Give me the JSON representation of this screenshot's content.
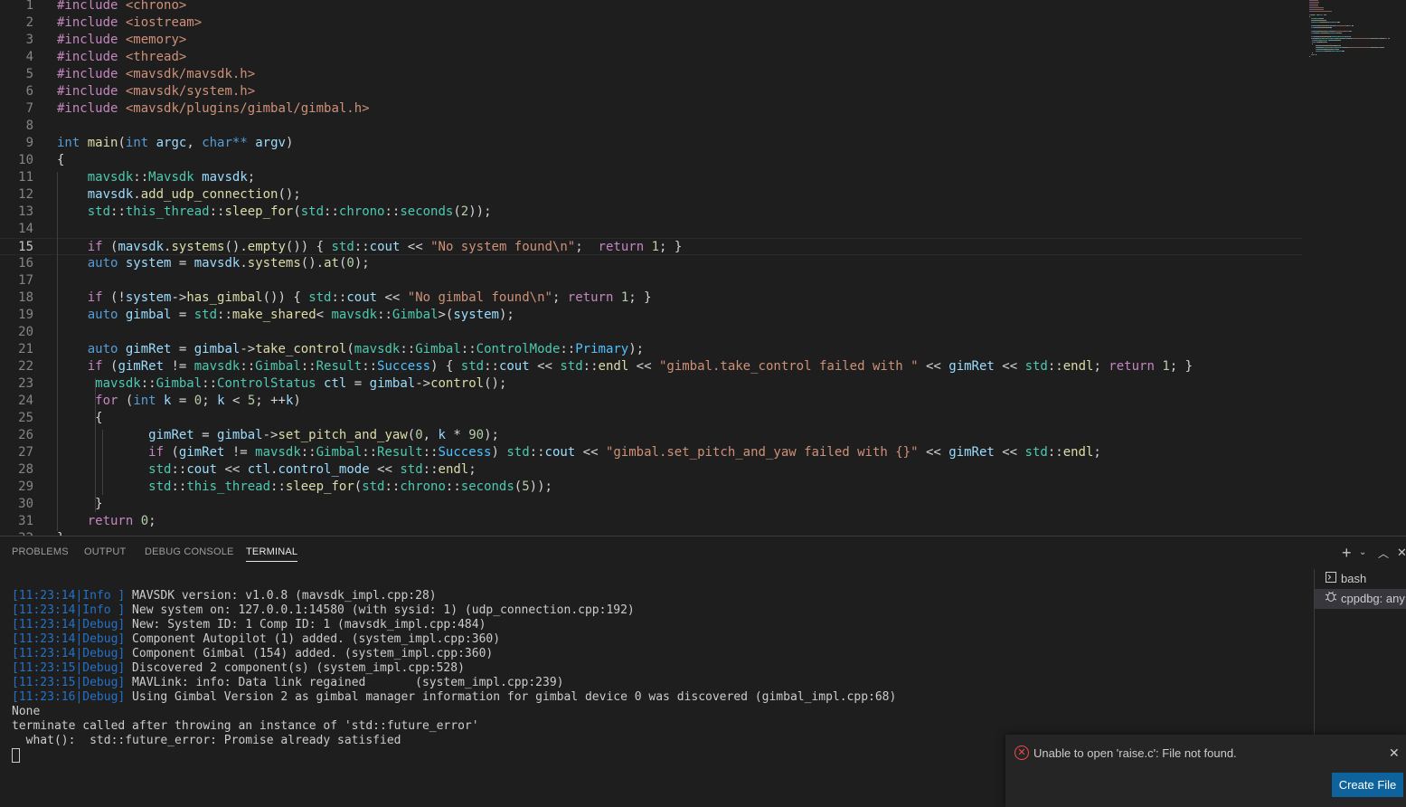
{
  "editor": {
    "current_line": 15,
    "lines": [
      [
        [
          "#include",
          "#c586c0"
        ],
        [
          " <chrono>",
          "#ce9178"
        ]
      ],
      [
        [
          "#include",
          "#c586c0"
        ],
        [
          " <iostream>",
          "#ce9178"
        ]
      ],
      [
        [
          "#include",
          "#c586c0"
        ],
        [
          " <memory>",
          "#ce9178"
        ]
      ],
      [
        [
          "#include",
          "#c586c0"
        ],
        [
          " <thread>",
          "#ce9178"
        ]
      ],
      [
        [
          "#include",
          "#c586c0"
        ],
        [
          " <mavsdk/mavsdk.h>",
          "#ce9178"
        ]
      ],
      [
        [
          "#include",
          "#c586c0"
        ],
        [
          " <mavsdk/system.h>",
          "#ce9178"
        ]
      ],
      [
        [
          "#include",
          "#c586c0"
        ],
        [
          " <mavsdk/plugins/gimbal/gimbal.h>",
          "#ce9178"
        ]
      ],
      [],
      [
        [
          "int",
          "#569cd6"
        ],
        [
          " ",
          "#d4d4d4"
        ],
        [
          "main",
          "#dcdcaa"
        ],
        [
          "(",
          "#d4d4d4"
        ],
        [
          "int",
          "#569cd6"
        ],
        [
          " ",
          "#d4d4d4"
        ],
        [
          "argc",
          "#9cdcfe"
        ],
        [
          ", ",
          "#d4d4d4"
        ],
        [
          "char**",
          "#569cd6"
        ],
        [
          " ",
          "#d4d4d4"
        ],
        [
          "argv",
          "#9cdcfe"
        ],
        [
          ")",
          "#d4d4d4"
        ]
      ],
      [
        [
          "{",
          "#d4d4d4"
        ]
      ],
      [
        [
          "    ",
          "#d4d4d4"
        ],
        [
          "mavsdk",
          "#4ec9b0"
        ],
        [
          "::",
          "#d4d4d4"
        ],
        [
          "Mavsdk",
          "#4ec9b0"
        ],
        [
          " ",
          "#d4d4d4"
        ],
        [
          "mavsdk",
          "#9cdcfe"
        ],
        [
          ";",
          "#d4d4d4"
        ]
      ],
      [
        [
          "    ",
          "#d4d4d4"
        ],
        [
          "mavsdk",
          "#9cdcfe"
        ],
        [
          ".",
          "#d4d4d4"
        ],
        [
          "add_udp_connection",
          "#dcdcaa"
        ],
        [
          "();",
          "#d4d4d4"
        ]
      ],
      [
        [
          "    ",
          "#d4d4d4"
        ],
        [
          "std",
          "#4ec9b0"
        ],
        [
          "::",
          "#d4d4d4"
        ],
        [
          "this_thread",
          "#4ec9b0"
        ],
        [
          "::",
          "#d4d4d4"
        ],
        [
          "sleep_for",
          "#dcdcaa"
        ],
        [
          "(",
          "#d4d4d4"
        ],
        [
          "std",
          "#4ec9b0"
        ],
        [
          "::",
          "#d4d4d4"
        ],
        [
          "chrono",
          "#4ec9b0"
        ],
        [
          "::",
          "#d4d4d4"
        ],
        [
          "seconds",
          "#4ec9b0"
        ],
        [
          "(",
          "#d4d4d4"
        ],
        [
          "2",
          "#b5cea8"
        ],
        [
          "));",
          "#d4d4d4"
        ]
      ],
      [],
      [
        [
          "    ",
          "#d4d4d4"
        ],
        [
          "if",
          "#c586c0"
        ],
        [
          " (",
          "#d4d4d4"
        ],
        [
          "mavsdk",
          "#9cdcfe"
        ],
        [
          ".",
          "#d4d4d4"
        ],
        [
          "systems",
          "#dcdcaa"
        ],
        [
          "().",
          "#d4d4d4"
        ],
        [
          "empty",
          "#dcdcaa"
        ],
        [
          "()) { ",
          "#d4d4d4"
        ],
        [
          "std",
          "#4ec9b0"
        ],
        [
          "::",
          "#d4d4d4"
        ],
        [
          "cout",
          "#9cdcfe"
        ],
        [
          " << ",
          "#d4d4d4"
        ],
        [
          "\"No system found\\n\"",
          "#ce9178"
        ],
        [
          ";  ",
          "#d4d4d4"
        ],
        [
          "return",
          "#c586c0"
        ],
        [
          " ",
          "#d4d4d4"
        ],
        [
          "1",
          "#b5cea8"
        ],
        [
          "; }",
          "#d4d4d4"
        ]
      ],
      [
        [
          "    ",
          "#d4d4d4"
        ],
        [
          "auto",
          "#569cd6"
        ],
        [
          " ",
          "#d4d4d4"
        ],
        [
          "system",
          "#9cdcfe"
        ],
        [
          " = ",
          "#d4d4d4"
        ],
        [
          "mavsdk",
          "#9cdcfe"
        ],
        [
          ".",
          "#d4d4d4"
        ],
        [
          "systems",
          "#dcdcaa"
        ],
        [
          "().",
          "#d4d4d4"
        ],
        [
          "at",
          "#dcdcaa"
        ],
        [
          "(",
          "#d4d4d4"
        ],
        [
          "0",
          "#b5cea8"
        ],
        [
          ");",
          "#d4d4d4"
        ]
      ],
      [],
      [
        [
          "    ",
          "#d4d4d4"
        ],
        [
          "if",
          "#c586c0"
        ],
        [
          " (!",
          "#d4d4d4"
        ],
        [
          "system",
          "#9cdcfe"
        ],
        [
          "->",
          "#d4d4d4"
        ],
        [
          "has_gimbal",
          "#dcdcaa"
        ],
        [
          "()) { ",
          "#d4d4d4"
        ],
        [
          "std",
          "#4ec9b0"
        ],
        [
          "::",
          "#d4d4d4"
        ],
        [
          "cout",
          "#9cdcfe"
        ],
        [
          " << ",
          "#d4d4d4"
        ],
        [
          "\"No gimbal found\\n\"",
          "#ce9178"
        ],
        [
          "; ",
          "#d4d4d4"
        ],
        [
          "return",
          "#c586c0"
        ],
        [
          " ",
          "#d4d4d4"
        ],
        [
          "1",
          "#b5cea8"
        ],
        [
          "; }",
          "#d4d4d4"
        ]
      ],
      [
        [
          "    ",
          "#d4d4d4"
        ],
        [
          "auto",
          "#569cd6"
        ],
        [
          " ",
          "#d4d4d4"
        ],
        [
          "gimbal",
          "#9cdcfe"
        ],
        [
          " = ",
          "#d4d4d4"
        ],
        [
          "std",
          "#4ec9b0"
        ],
        [
          "::",
          "#d4d4d4"
        ],
        [
          "make_shared",
          "#dcdcaa"
        ],
        [
          "< ",
          "#d4d4d4"
        ],
        [
          "mavsdk",
          "#4ec9b0"
        ],
        [
          "::",
          "#d4d4d4"
        ],
        [
          "Gimbal",
          "#4ec9b0"
        ],
        [
          ">(",
          "#d4d4d4"
        ],
        [
          "system",
          "#9cdcfe"
        ],
        [
          ");",
          "#d4d4d4"
        ]
      ],
      [],
      [
        [
          "    ",
          "#d4d4d4"
        ],
        [
          "auto",
          "#569cd6"
        ],
        [
          " ",
          "#d4d4d4"
        ],
        [
          "gimRet",
          "#9cdcfe"
        ],
        [
          " = ",
          "#d4d4d4"
        ],
        [
          "gimbal",
          "#9cdcfe"
        ],
        [
          "->",
          "#d4d4d4"
        ],
        [
          "take_control",
          "#dcdcaa"
        ],
        [
          "(",
          "#d4d4d4"
        ],
        [
          "mavsdk",
          "#4ec9b0"
        ],
        [
          "::",
          "#d4d4d4"
        ],
        [
          "Gimbal",
          "#4ec9b0"
        ],
        [
          "::",
          "#d4d4d4"
        ],
        [
          "ControlMode",
          "#4ec9b0"
        ],
        [
          "::",
          "#d4d4d4"
        ],
        [
          "Primary",
          "#4fc1ff"
        ],
        [
          ");",
          "#d4d4d4"
        ]
      ],
      [
        [
          "    ",
          "#d4d4d4"
        ],
        [
          "if",
          "#c586c0"
        ],
        [
          " (",
          "#d4d4d4"
        ],
        [
          "gimRet",
          "#9cdcfe"
        ],
        [
          " != ",
          "#d4d4d4"
        ],
        [
          "mavsdk",
          "#4ec9b0"
        ],
        [
          "::",
          "#d4d4d4"
        ],
        [
          "Gimbal",
          "#4ec9b0"
        ],
        [
          "::",
          "#d4d4d4"
        ],
        [
          "Result",
          "#4ec9b0"
        ],
        [
          "::",
          "#d4d4d4"
        ],
        [
          "Success",
          "#4fc1ff"
        ],
        [
          ") { ",
          "#d4d4d4"
        ],
        [
          "std",
          "#4ec9b0"
        ],
        [
          "::",
          "#d4d4d4"
        ],
        [
          "cout",
          "#9cdcfe"
        ],
        [
          " << ",
          "#d4d4d4"
        ],
        [
          "std",
          "#4ec9b0"
        ],
        [
          "::",
          "#d4d4d4"
        ],
        [
          "endl",
          "#dcdcaa"
        ],
        [
          " << ",
          "#d4d4d4"
        ],
        [
          "\"gimbal.take_control failed with \"",
          "#ce9178"
        ],
        [
          " << ",
          "#d4d4d4"
        ],
        [
          "gimRet",
          "#9cdcfe"
        ],
        [
          " << ",
          "#d4d4d4"
        ],
        [
          "std",
          "#4ec9b0"
        ],
        [
          "::",
          "#d4d4d4"
        ],
        [
          "endl",
          "#dcdcaa"
        ],
        [
          "; ",
          "#d4d4d4"
        ],
        [
          "return",
          "#c586c0"
        ],
        [
          " ",
          "#d4d4d4"
        ],
        [
          "1",
          "#b5cea8"
        ],
        [
          "; }",
          "#d4d4d4"
        ]
      ],
      [
        [
          "     ",
          "#d4d4d4"
        ],
        [
          "mavsdk",
          "#4ec9b0"
        ],
        [
          "::",
          "#d4d4d4"
        ],
        [
          "Gimbal",
          "#4ec9b0"
        ],
        [
          "::",
          "#d4d4d4"
        ],
        [
          "ControlStatus",
          "#4ec9b0"
        ],
        [
          " ",
          "#d4d4d4"
        ],
        [
          "ctl",
          "#9cdcfe"
        ],
        [
          " = ",
          "#d4d4d4"
        ],
        [
          "gimbal",
          "#9cdcfe"
        ],
        [
          "->",
          "#d4d4d4"
        ],
        [
          "control",
          "#dcdcaa"
        ],
        [
          "();",
          "#d4d4d4"
        ]
      ],
      [
        [
          "     ",
          "#d4d4d4"
        ],
        [
          "for",
          "#c586c0"
        ],
        [
          " (",
          "#d4d4d4"
        ],
        [
          "int",
          "#569cd6"
        ],
        [
          " ",
          "#d4d4d4"
        ],
        [
          "k",
          "#9cdcfe"
        ],
        [
          " = ",
          "#d4d4d4"
        ],
        [
          "0",
          "#b5cea8"
        ],
        [
          "; ",
          "#d4d4d4"
        ],
        [
          "k",
          "#9cdcfe"
        ],
        [
          " < ",
          "#d4d4d4"
        ],
        [
          "5",
          "#b5cea8"
        ],
        [
          "; ++",
          "#d4d4d4"
        ],
        [
          "k",
          "#9cdcfe"
        ],
        [
          ")",
          "#d4d4d4"
        ]
      ],
      [
        [
          "     ",
          "#d4d4d4"
        ],
        [
          "{",
          "#d4d4d4"
        ]
      ],
      [
        [
          "            ",
          "#d4d4d4"
        ],
        [
          "gimRet",
          "#9cdcfe"
        ],
        [
          " = ",
          "#d4d4d4"
        ],
        [
          "gimbal",
          "#9cdcfe"
        ],
        [
          "->",
          "#d4d4d4"
        ],
        [
          "set_pitch_and_yaw",
          "#dcdcaa"
        ],
        [
          "(",
          "#d4d4d4"
        ],
        [
          "0",
          "#b5cea8"
        ],
        [
          ", ",
          "#d4d4d4"
        ],
        [
          "k",
          "#9cdcfe"
        ],
        [
          " * ",
          "#d4d4d4"
        ],
        [
          "90",
          "#b5cea8"
        ],
        [
          ");",
          "#d4d4d4"
        ]
      ],
      [
        [
          "            ",
          "#d4d4d4"
        ],
        [
          "if",
          "#c586c0"
        ],
        [
          " (",
          "#d4d4d4"
        ],
        [
          "gimRet",
          "#9cdcfe"
        ],
        [
          " != ",
          "#d4d4d4"
        ],
        [
          "mavsdk",
          "#4ec9b0"
        ],
        [
          "::",
          "#d4d4d4"
        ],
        [
          "Gimbal",
          "#4ec9b0"
        ],
        [
          "::",
          "#d4d4d4"
        ],
        [
          "Result",
          "#4ec9b0"
        ],
        [
          "::",
          "#d4d4d4"
        ],
        [
          "Success",
          "#4fc1ff"
        ],
        [
          ") ",
          "#d4d4d4"
        ],
        [
          "std",
          "#4ec9b0"
        ],
        [
          "::",
          "#d4d4d4"
        ],
        [
          "cout",
          "#9cdcfe"
        ],
        [
          " << ",
          "#d4d4d4"
        ],
        [
          "\"gimbal.set_pitch_and_yaw failed with {}\"",
          "#ce9178"
        ],
        [
          " << ",
          "#d4d4d4"
        ],
        [
          "gimRet",
          "#9cdcfe"
        ],
        [
          " << ",
          "#d4d4d4"
        ],
        [
          "std",
          "#4ec9b0"
        ],
        [
          "::",
          "#d4d4d4"
        ],
        [
          "endl",
          "#dcdcaa"
        ],
        [
          ";",
          "#d4d4d4"
        ]
      ],
      [
        [
          "            ",
          "#d4d4d4"
        ],
        [
          "std",
          "#4ec9b0"
        ],
        [
          "::",
          "#d4d4d4"
        ],
        [
          "cout",
          "#9cdcfe"
        ],
        [
          " << ",
          "#d4d4d4"
        ],
        [
          "ctl",
          "#9cdcfe"
        ],
        [
          ".",
          "#d4d4d4"
        ],
        [
          "control_mode",
          "#9cdcfe"
        ],
        [
          " << ",
          "#d4d4d4"
        ],
        [
          "std",
          "#4ec9b0"
        ],
        [
          "::",
          "#d4d4d4"
        ],
        [
          "endl",
          "#dcdcaa"
        ],
        [
          ";",
          "#d4d4d4"
        ]
      ],
      [
        [
          "            ",
          "#d4d4d4"
        ],
        [
          "std",
          "#4ec9b0"
        ],
        [
          "::",
          "#d4d4d4"
        ],
        [
          "this_thread",
          "#4ec9b0"
        ],
        [
          "::",
          "#d4d4d4"
        ],
        [
          "sleep_for",
          "#dcdcaa"
        ],
        [
          "(",
          "#d4d4d4"
        ],
        [
          "std",
          "#4ec9b0"
        ],
        [
          "::",
          "#d4d4d4"
        ],
        [
          "chrono",
          "#4ec9b0"
        ],
        [
          "::",
          "#d4d4d4"
        ],
        [
          "seconds",
          "#4ec9b0"
        ],
        [
          "(",
          "#d4d4d4"
        ],
        [
          "5",
          "#b5cea8"
        ],
        [
          "));",
          "#d4d4d4"
        ]
      ],
      [
        [
          "     ",
          "#d4d4d4"
        ],
        [
          "}",
          "#d4d4d4"
        ]
      ],
      [
        [
          "    ",
          "#d4d4d4"
        ],
        [
          "return",
          "#c586c0"
        ],
        [
          " ",
          "#d4d4d4"
        ],
        [
          "0",
          "#b5cea8"
        ],
        [
          ";",
          "#d4d4d4"
        ]
      ],
      [
        [
          "}",
          "#d4d4d4"
        ]
      ]
    ]
  },
  "panel": {
    "tabs": [
      "PROBLEMS",
      "OUTPUT",
      "DEBUG CONSOLE",
      "TERMINAL"
    ],
    "active_tab": 3,
    "terminal_lines": [
      {
        "tag": "[11:23:14|Info ]",
        "text": " MAVSDK version: v1.0.8 (mavsdk_impl.cpp:28)"
      },
      {
        "tag": "[11:23:14|Info ]",
        "text": " New system on: 127.0.0.1:14580 (with sysid: 1) (udp_connection.cpp:192)"
      },
      {
        "tag": "[11:23:14|Debug]",
        "text": " New: System ID: 1 Comp ID: 1 (mavsdk_impl.cpp:484)"
      },
      {
        "tag": "[11:23:14|Debug]",
        "text": " Component Autopilot (1) added. (system_impl.cpp:360)"
      },
      {
        "tag": "[11:23:14|Debug]",
        "text": " Component Gimbal (154) added. (system_impl.cpp:360)"
      },
      {
        "tag": "[11:23:15|Debug]",
        "text": " Discovered 2 component(s) (system_impl.cpp:528)"
      },
      {
        "tag": "[11:23:15|Debug]",
        "text": " MAVLink: info: Data link regained       (system_impl.cpp:239)"
      },
      {
        "tag": "[11:23:16|Debug]",
        "text": " Using Gimbal Version 2 as gimbal manager information for gimbal device 0 was discovered (gimbal_impl.cpp:68)"
      },
      {
        "tag": "",
        "text": "None"
      },
      {
        "tag": "",
        "text": "terminate called after throwing an instance of 'std::future_error'"
      },
      {
        "tag": "",
        "text": "  what():  std::future_error: Promise already satisfied"
      }
    ],
    "terminals": [
      {
        "label": "bash",
        "icon": "terminal-icon",
        "selected": false
      },
      {
        "label": "cppdbg: any",
        "icon": "debug-icon",
        "selected": true
      }
    ]
  },
  "notification": {
    "message": "Unable to open 'raise.c': File not found.",
    "button": "Create File",
    "icon": "error-icon"
  }
}
